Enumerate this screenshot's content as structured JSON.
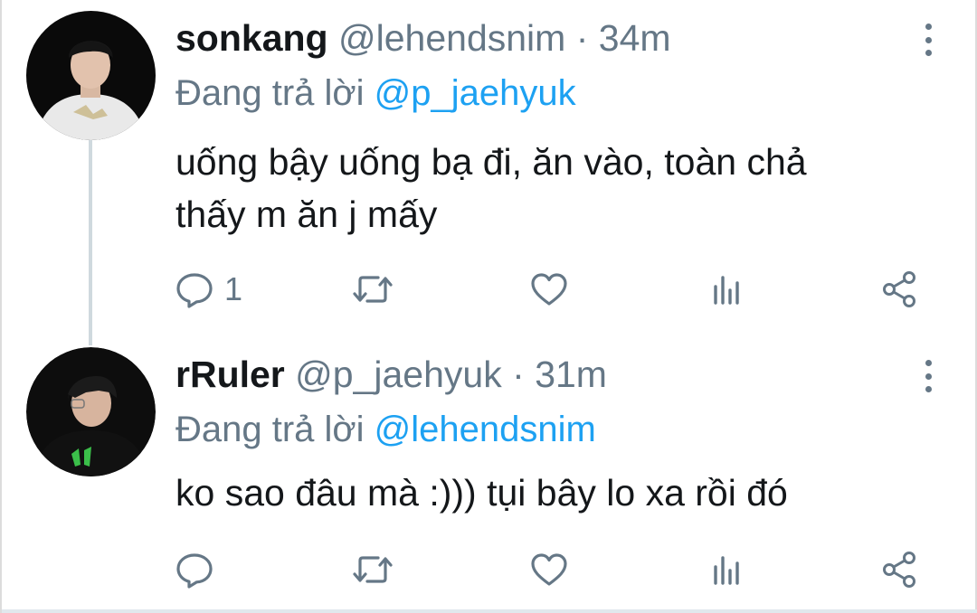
{
  "tweets": [
    {
      "name": "sonkang",
      "handle": "@lehendsnim",
      "separator": "·",
      "time": "34m",
      "reply_prefix": "Đang trả lời",
      "reply_to": "@p_jaehyuk",
      "text_line1": "uống bậy uống bạ đi, ăn vào, toàn chả",
      "text_line2": "thấy m ăn j mấy",
      "reply_count": "1",
      "icons": [
        "reply-icon",
        "retweet-icon",
        "like-icon",
        "analytics-icon",
        "share-icon"
      ]
    },
    {
      "name": "rRuler",
      "handle": "@p_jaehyuk",
      "separator": "·",
      "time": "31m",
      "reply_prefix": "Đang trả lời",
      "reply_to": "@lehendsnim",
      "text_line1": "ko sao đâu mà :))) tụi bây lo xa rồi đó",
      "reply_count": "",
      "icons": [
        "reply-icon",
        "retweet-icon",
        "like-icon",
        "analytics-icon",
        "share-icon"
      ]
    }
  ],
  "colors": {
    "text": "#14171a",
    "secondary": "#657786",
    "link": "#1da1f2",
    "thread_line": "#cfd9de"
  }
}
